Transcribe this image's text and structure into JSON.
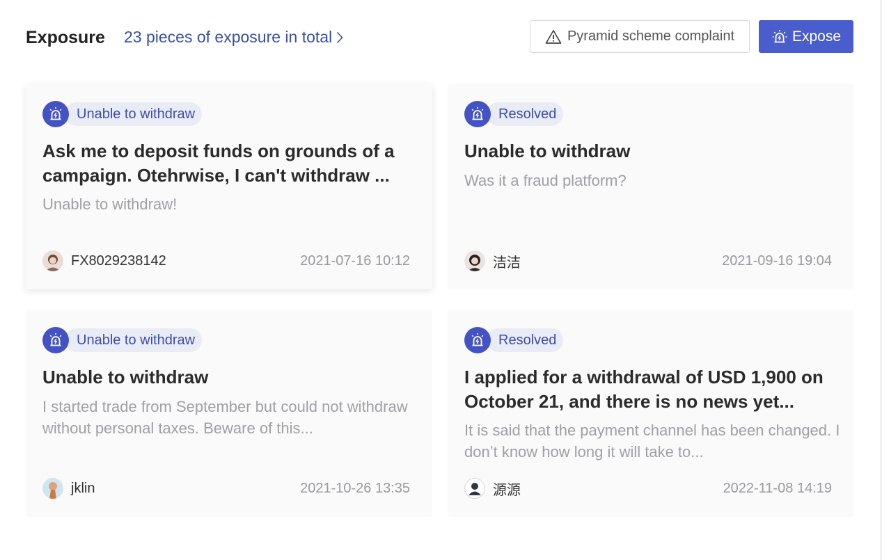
{
  "header": {
    "title": "Exposure",
    "total_link": "23 pieces of exposure in total",
    "complaint_button": "Pyramid scheme complaint",
    "expose_button": "Expose"
  },
  "cards": [
    {
      "badge": "Unable to withdraw",
      "title": "Ask me to deposit funds on grounds of a campaign. Otehrwise, I can't withdraw ...",
      "description": "Unable to withdraw!",
      "user": "FX8029238142",
      "date": "2021-07-16 10:12"
    },
    {
      "badge": "Resolved",
      "title": "Unable to withdraw",
      "description": "Was it a fraud platform?",
      "user": "洁洁",
      "date": "2021-09-16 19:04"
    },
    {
      "badge": "Unable to withdraw",
      "title": "Unable to withdraw",
      "description": "I started trade from September but could not withdraw without personal taxes. Beware of this...",
      "user": "jklin",
      "date": "2021-10-26 13:35"
    },
    {
      "badge": "Resolved",
      "title": "I applied for a withdrawal of USD 1,900 on October 21, and there is no news yet...",
      "description": "It is said that the payment channel has been changed. I don’t know how long it will take to...",
      "user": "源源",
      "date": "2022-11-08 14:19"
    }
  ],
  "colors": {
    "accent": "#4a5dcc",
    "link": "#3c4ea8",
    "badge_bg": "#eaecf5",
    "muted_text": "#a0a0a4"
  },
  "icons": {
    "badge": "alarm-light-icon",
    "complaint": "warning-triangle-icon",
    "expose": "alarm-light-icon",
    "link": "chevron-right-icon"
  }
}
